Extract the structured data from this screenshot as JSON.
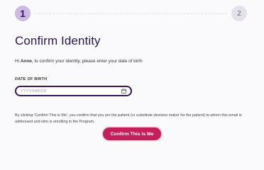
{
  "stepper": {
    "current_step": "1",
    "next_step": "2"
  },
  "page": {
    "title": "Confirm Identity",
    "greeting_prefix": "Hi ",
    "user_name": "Anne",
    "greeting_suffix": ", to confirm your identity, please enter your date of birth"
  },
  "dob": {
    "label": "DATE OF BIRTH",
    "placeholder": "YYYY/MM/DD",
    "value": "",
    "icon": "calendar-icon"
  },
  "consent": {
    "text": "By clicking 'Confirm This is Me', you confirm that you are the patient (or substitute decision maker for the patient) to whom this email is addressed and who is enrolling in the Program."
  },
  "actions": {
    "confirm_label": "Confirm This is Me"
  },
  "colors": {
    "primary": "#c41e5c",
    "title": "#2c1650",
    "step_active_bg": "#cdb9e6",
    "step_inactive_bg": "#e4e1ea",
    "field_border": "#3b1656"
  }
}
